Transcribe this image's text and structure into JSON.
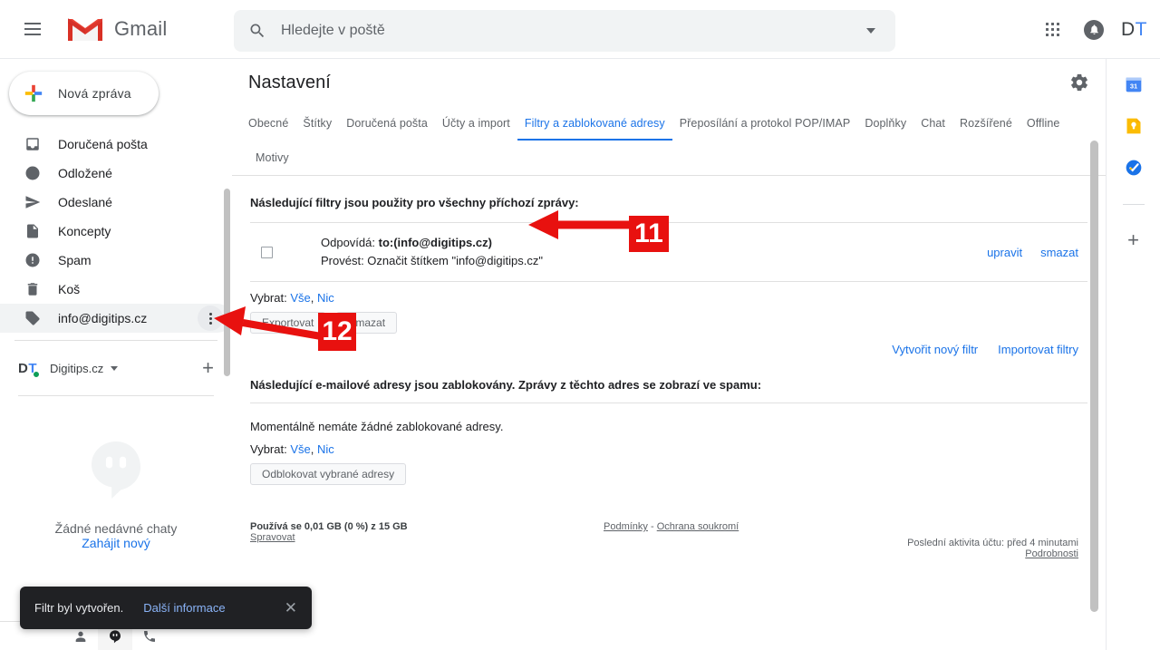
{
  "topbar": {
    "menu_icon": "hamburger-menu-icon",
    "logo_text": "Gmail",
    "search_placeholder": "Hledejte v poště",
    "search_value": "",
    "search_icon": "search-icon",
    "options_icon": "chevron-down-icon",
    "apps_icon": "apps-grid-icon",
    "notifications_icon": "bell-icon",
    "avatar_initials_first": "D",
    "avatar_initials_second": "T"
  },
  "sidebar": {
    "compose_label": "Nová zpráva",
    "items": [
      {
        "label": "Doručená pošta",
        "icon": "inbox-icon",
        "active": false
      },
      {
        "label": "Odložené",
        "icon": "clock-icon",
        "active": false
      },
      {
        "label": "Odeslané",
        "icon": "send-icon",
        "active": false
      },
      {
        "label": "Koncepty",
        "icon": "draft-icon",
        "active": false
      },
      {
        "label": "Spam",
        "icon": "spam-icon",
        "active": false
      },
      {
        "label": "Koš",
        "icon": "trash-icon",
        "active": false
      },
      {
        "label": "info@digitips.cz",
        "icon": "label-tag-icon",
        "active": true
      }
    ],
    "account": {
      "badge_first": "D",
      "badge_second": "T",
      "name": "Digitips.cz",
      "add_label": "+"
    },
    "chat": {
      "empty_text": "Žádné nedávné chaty",
      "start_link": "Zahájit nový",
      "bar_icons": [
        "contacts-person-icon",
        "hangouts-chat-icon",
        "phone-call-icon"
      ]
    }
  },
  "main": {
    "title": "Nastavení",
    "gear_icon": "gear-icon",
    "tabs": [
      {
        "label": "Obecné",
        "active": false
      },
      {
        "label": "Štítky",
        "active": false
      },
      {
        "label": "Doručená pošta",
        "active": false
      },
      {
        "label": "Účty a import",
        "active": false
      },
      {
        "label": "Filtry a zablokované adresy",
        "active": true
      },
      {
        "label": "Přeposílání a protokol POP/IMAP",
        "active": false
      },
      {
        "label": "Doplňky",
        "active": false
      },
      {
        "label": "Chat",
        "active": false
      },
      {
        "label": "Rozšířené",
        "active": false
      },
      {
        "label": "Offline",
        "active": false
      },
      {
        "label": "Motivy",
        "active": false
      }
    ],
    "filters_heading": "Následující filtry jsou použity pro všechny příchozí zprávy:",
    "filter_rows": [
      {
        "match_prefix": "Odpovídá: ",
        "match_value": "to:(info@digitips.cz)",
        "action_text": "Provést: Označit štítkem \"info@digitips.cz\"",
        "edit_label": "upravit",
        "delete_label": "smazat"
      }
    ],
    "select_label": "Vybrat:",
    "select_all": "Vše",
    "select_none": "Nic",
    "export_button": "Exportovat",
    "delete_button": "Smazat",
    "create_filter_link": "Vytvořit nový filtr",
    "import_filters_link": "Importovat filtry",
    "blocked_heading": "Následující e-mailové adresy jsou zablokovány. Zprávy z těchto adres se zobrazí ve spamu:",
    "blocked_empty": "Momentálně nemáte žádné zablokované adresy.",
    "unblock_button": "Odblokovat vybrané adresy"
  },
  "footer": {
    "storage_text": "Používá se 0,01 GB (0 %) z 15 GB",
    "manage_link": "Spravovat",
    "terms_link": "Podmínky",
    "terms_sep": "-",
    "privacy_link": "Ochrana soukromí",
    "activity_text": "Poslední aktivita účtu: před 4 minutami",
    "details_link": "Podrobnosti"
  },
  "rail": {
    "items": [
      {
        "name": "google-calendar-icon",
        "day": "31"
      },
      {
        "name": "google-keep-icon"
      },
      {
        "name": "google-tasks-icon"
      }
    ],
    "add_label": "+"
  },
  "toast": {
    "message": "Filtr byl vytvořen.",
    "link": "Další informace",
    "close_icon": "close-icon"
  },
  "annotations": {
    "color": "#e8110f",
    "markers": [
      {
        "number": "11",
        "target": "filter-row"
      },
      {
        "number": "12",
        "target": "label-overflow-menu"
      }
    ]
  }
}
